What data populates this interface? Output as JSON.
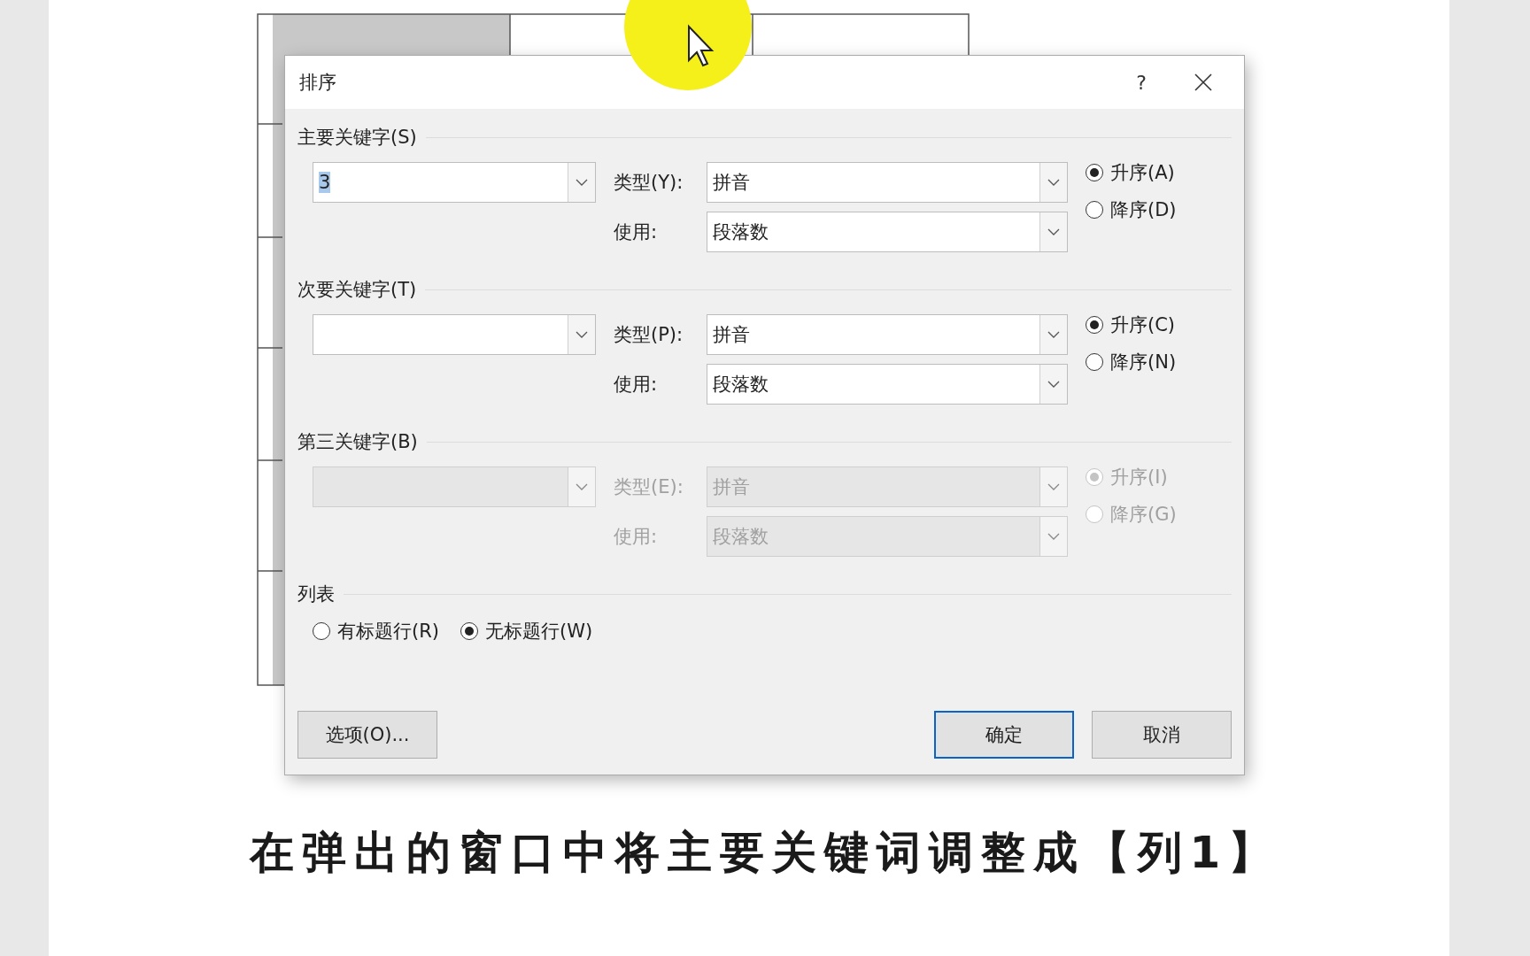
{
  "dialog": {
    "title": "排序",
    "help": "?",
    "keys": [
      {
        "heading": "主要关键字(S)",
        "value": "3",
        "value_selected": true,
        "disabled": false,
        "type_label": "类型(Y):",
        "type_value": "拼音",
        "use_label": "使用:",
        "use_value": "段落数",
        "order": [
          {
            "label": "升序(A)",
            "selected": true
          },
          {
            "label": "降序(D)",
            "selected": false
          }
        ]
      },
      {
        "heading": "次要关键字(T)",
        "disabled": false,
        "type_label": "类型(P):",
        "type_value": "拼音",
        "use_label": "使用:",
        "use_value": "段落数",
        "order": [
          {
            "label": "升序(C)",
            "selected": true
          },
          {
            "label": "降序(N)",
            "selected": false
          }
        ]
      },
      {
        "heading": "第三关键字(B)",
        "disabled": true,
        "type_label": "类型(E):",
        "type_value": "拼音",
        "use_label": "使用:",
        "use_value": "段落数",
        "order": [
          {
            "label": "升序(I)",
            "selected": true
          },
          {
            "label": "降序(G)",
            "selected": false
          }
        ]
      }
    ],
    "list": {
      "heading": "列表",
      "options": [
        {
          "label": "有标题行(R)",
          "selected": false
        },
        {
          "label": "无标题行(W)",
          "selected": true
        }
      ]
    },
    "buttons": [
      {
        "label": "选项(O)...",
        "default": false
      },
      {
        "label": "确定",
        "default": true
      },
      {
        "label": "取消",
        "default": false
      }
    ]
  },
  "caption": "在弹出的窗口中将主要关键词调整成【列1】"
}
